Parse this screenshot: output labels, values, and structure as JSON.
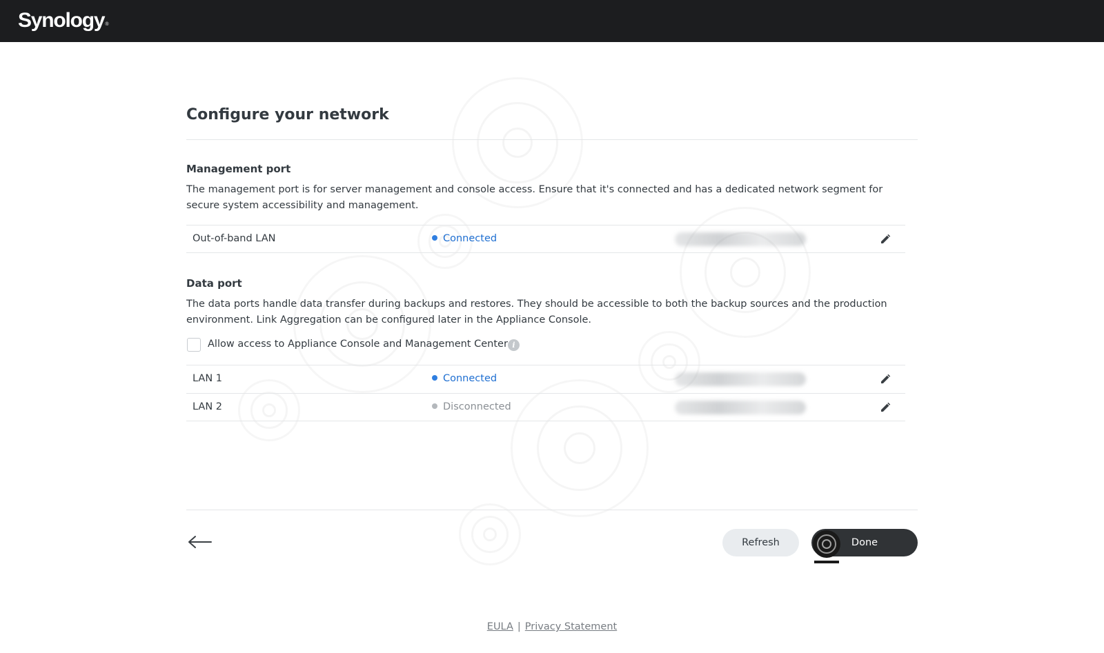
{
  "header": {
    "logo_text": "Synology",
    "logo_trademark": "®"
  },
  "page": {
    "title": "Configure your network"
  },
  "management": {
    "title": "Management port",
    "description": "The management port is for server management and console access. Ensure that it's connected and has a dedicated network segment for secure system accessibility and management.",
    "ports": [
      {
        "name": "Out-of-band LAN",
        "status": "Connected",
        "status_color": "#1f6fd1",
        "dot_color": "#2f7ee0"
      }
    ]
  },
  "data": {
    "title": "Data port",
    "description": "The data ports handle data transfer during backups and restores. They should be accessible to both the backup sources and the production environment. Link Aggregation can be configured later in the Appliance Console.",
    "checkbox_label": "Allow access to Appliance Console and Management Center",
    "checkbox_checked": false,
    "ports": [
      {
        "name": "LAN 1",
        "status": "Connected",
        "status_color": "#1f6fd1",
        "dot_color": "#2f7ee0"
      },
      {
        "name": "LAN 2",
        "status": "Disconnected",
        "status_color": "#8a8f94",
        "dot_color": "#b4b8bc"
      }
    ]
  },
  "buttons": {
    "refresh": "Refresh",
    "done": "Done"
  },
  "footer": {
    "eula": "EULA",
    "separator": "|",
    "privacy": "Privacy Statement"
  },
  "icons": {
    "back": "arrow-left-icon",
    "edit": "pencil-icon",
    "info": "info-icon"
  }
}
